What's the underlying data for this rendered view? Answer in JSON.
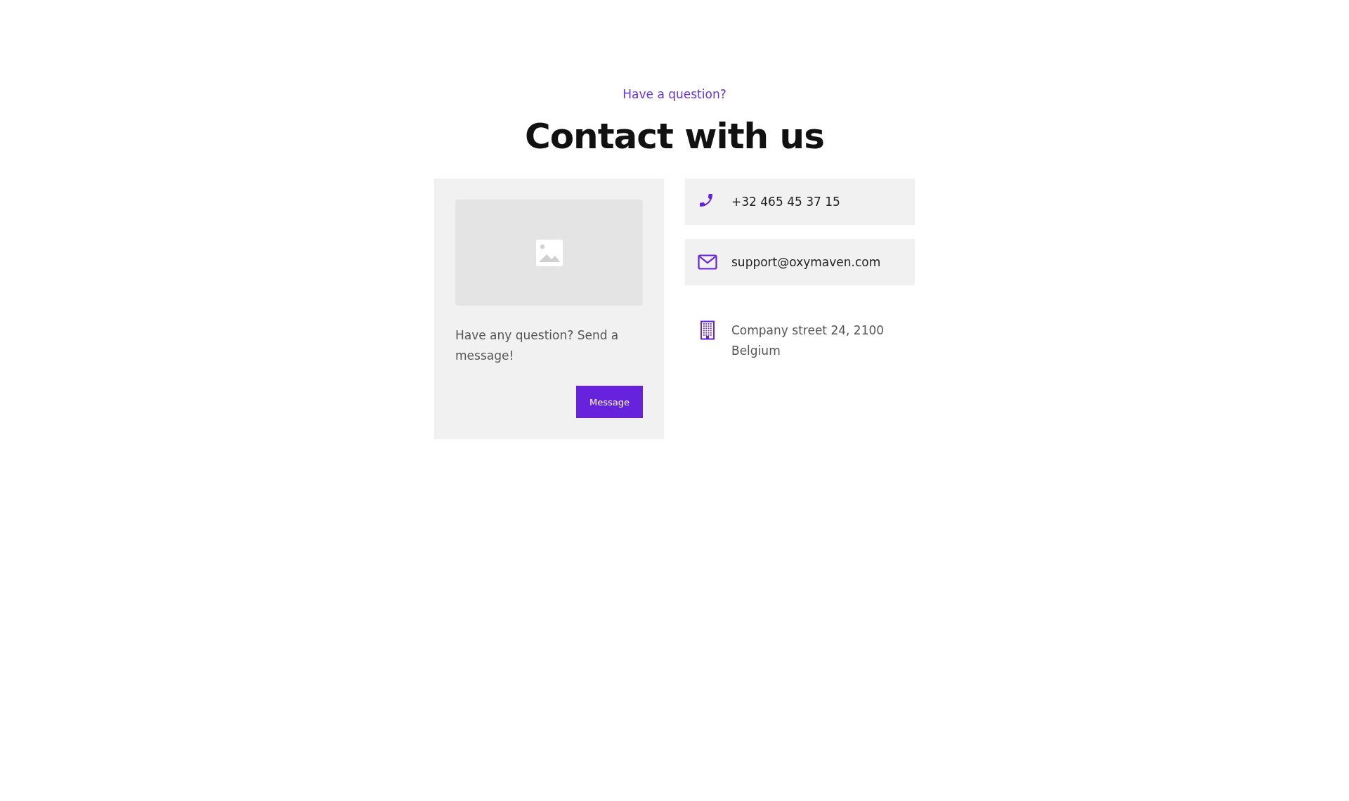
{
  "header": {
    "eyebrow": "Have a question?",
    "title": "Contact with us"
  },
  "message_card": {
    "image": {
      "kind": "placeholder"
    },
    "text": "Have any question? Send a message!",
    "button": "Message"
  },
  "contacts": [
    {
      "kind": "phone",
      "text": "+32 465 45 37 15"
    },
    {
      "kind": "email",
      "text": "support@oxymaven.com"
    },
    {
      "kind": "address",
      "text": "Company street 24, 2100 Belgium"
    }
  ]
}
